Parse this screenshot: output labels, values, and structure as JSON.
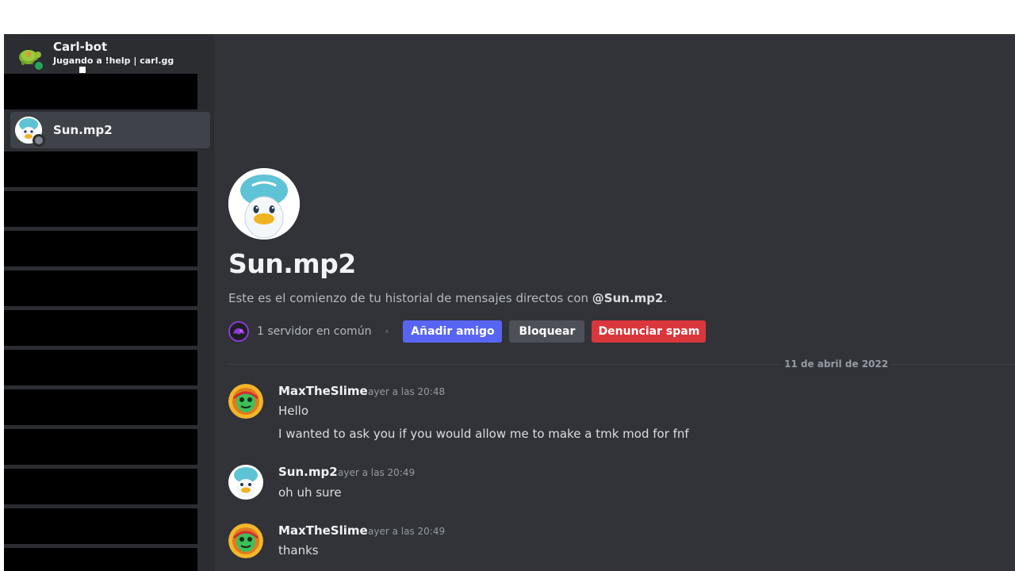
{
  "sidebar": {
    "bot": {
      "name": "Carl-bot",
      "status": "Jugando a !help | carl.gg",
      "status_color": "#23a55a"
    },
    "selected_dm": {
      "name": "Sun.mp2",
      "status_color": "#80848e"
    }
  },
  "profile": {
    "name": "Sun.mp2",
    "intro_prefix": "Este es el comienzo de tu historial de mensajes directos con ",
    "intro_handle": "@Sun.mp2",
    "intro_suffix": ".",
    "mutual_servers": "1 servidor en común",
    "buttons": {
      "add_friend": "Añadir amigo",
      "block": "Bloquear",
      "report_spam": "Denunciar spam"
    }
  },
  "date_divider": "11 de abril de 2022",
  "messages": [
    {
      "author": "MaxTheSlime",
      "time": "ayer a las 20:48",
      "lines": [
        "Hello",
        "I wanted to ask you if you would allow me to make a tmk mod for fnf"
      ]
    },
    {
      "author": "Sun.mp2",
      "time": "ayer a las 20:49",
      "lines": [
        "oh uh sure"
      ]
    },
    {
      "author": "MaxTheSlime",
      "time": "ayer a las 20:49",
      "lines": [
        "thanks"
      ]
    }
  ],
  "colors": {
    "accent": "#5865f2",
    "danger": "#da373c",
    "sidebar": "#2b2d31",
    "chat": "#313338"
  }
}
